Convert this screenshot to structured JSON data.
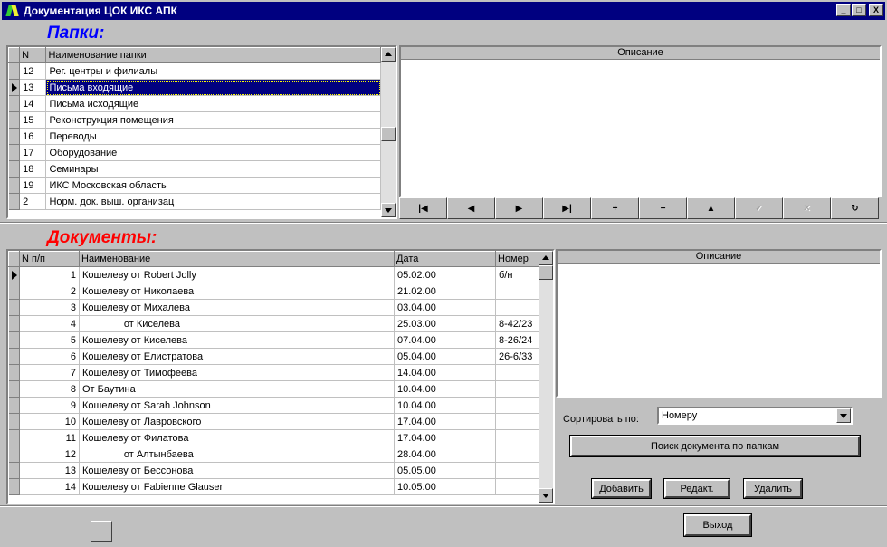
{
  "window": {
    "title": "Документация ЦОК ИКС АПК",
    "minimize": "_",
    "maximize": "□",
    "close": "X"
  },
  "folders": {
    "title": "Папки:",
    "title_color": "#0000ff",
    "columns": [
      "N",
      "Наименование папки"
    ],
    "rows": [
      {
        "n": "12",
        "name": "Рег.  центры и филиалы"
      },
      {
        "n": "13",
        "name": "Письма входящие"
      },
      {
        "n": "14",
        "name": "Письма исходящие"
      },
      {
        "n": "15",
        "name": "Реконструкция помещения"
      },
      {
        "n": "16",
        "name": "Переводы"
      },
      {
        "n": "17",
        "name": "Оборудование"
      },
      {
        "n": "18",
        "name": "Семинары"
      },
      {
        "n": "19",
        "name": "ИКС Московская область"
      },
      {
        "n": "2",
        "name": "Норм. док. выш. организац"
      }
    ],
    "selected_index": 1,
    "description_header": "Описание"
  },
  "navigator": {
    "buttons": [
      {
        "name": "first-record-button",
        "glyph": "|◀",
        "enabled": true
      },
      {
        "name": "prior-record-button",
        "glyph": "◀",
        "enabled": true
      },
      {
        "name": "next-record-button",
        "glyph": "▶",
        "enabled": true
      },
      {
        "name": "last-record-button",
        "glyph": "▶|",
        "enabled": true
      },
      {
        "name": "insert-record-button",
        "glyph": "+",
        "enabled": true
      },
      {
        "name": "delete-record-button",
        "glyph": "−",
        "enabled": true
      },
      {
        "name": "edit-record-button",
        "glyph": "▲",
        "enabled": true
      },
      {
        "name": "post-record-button",
        "glyph": "✓",
        "enabled": false
      },
      {
        "name": "cancel-record-button",
        "glyph": "✕",
        "enabled": false
      },
      {
        "name": "refresh-button",
        "glyph": "↻",
        "enabled": true
      }
    ]
  },
  "documents": {
    "title": "Документы:",
    "title_color": "#ff0000",
    "columns": [
      "N п/п",
      "Наименование",
      "Дата",
      "Номер"
    ],
    "rows": [
      {
        "n": "1",
        "name": "Кошелеву от Robert Jolly",
        "date": "05.02.00",
        "num": "б/н"
      },
      {
        "n": "2",
        "name": "Кошелеву от Николаева",
        "date": "21.02.00",
        "num": ""
      },
      {
        "n": "3",
        "name": "Кошелеву от Михалева",
        "date": "03.04.00",
        "num": ""
      },
      {
        "n": "4",
        "name": "               от Киселева",
        "date": "25.03.00",
        "num": "8-42/23"
      },
      {
        "n": "5",
        "name": "Кошелеву от Киселева",
        "date": "07.04.00",
        "num": "8-26/24"
      },
      {
        "n": "6",
        "name": "Кошелеву от Елистратова",
        "date": "05.04.00",
        "num": "26-6/33"
      },
      {
        "n": "7",
        "name": "Кошелеву от Тимофеева",
        "date": "14.04.00",
        "num": ""
      },
      {
        "n": "8",
        "name": "От Баутина",
        "date": "10.04.00",
        "num": ""
      },
      {
        "n": "9",
        "name": "Кошелеву от Sarah Johnson",
        "date": "10.04.00",
        "num": ""
      },
      {
        "n": "10",
        "name": "Кошелеву от Лавровского",
        "date": "17.04.00",
        "num": ""
      },
      {
        "n": "11",
        "name": "Кошелеву от Филатова",
        "date": "17.04.00",
        "num": ""
      },
      {
        "n": "12",
        "name": "               от Алтынбаева",
        "date": "28.04.00",
        "num": ""
      },
      {
        "n": "13",
        "name": "Кошелеву от Бессонова",
        "date": "05.05.00",
        "num": ""
      },
      {
        "n": "14",
        "name": "Кошелеву от Fabienne Glauser",
        "date": "10.05.00",
        "num": ""
      }
    ],
    "current_index": 0,
    "description_header": "Описание"
  },
  "controls": {
    "sort_label": "Сортировать по:",
    "sort_value": "Номеру",
    "search_button": "Поиск документа по папкам",
    "add_button": "Добавить",
    "edit_button": "Редакт.",
    "delete_button": "Удалить"
  },
  "footer": {
    "exit_button": "Выход"
  }
}
